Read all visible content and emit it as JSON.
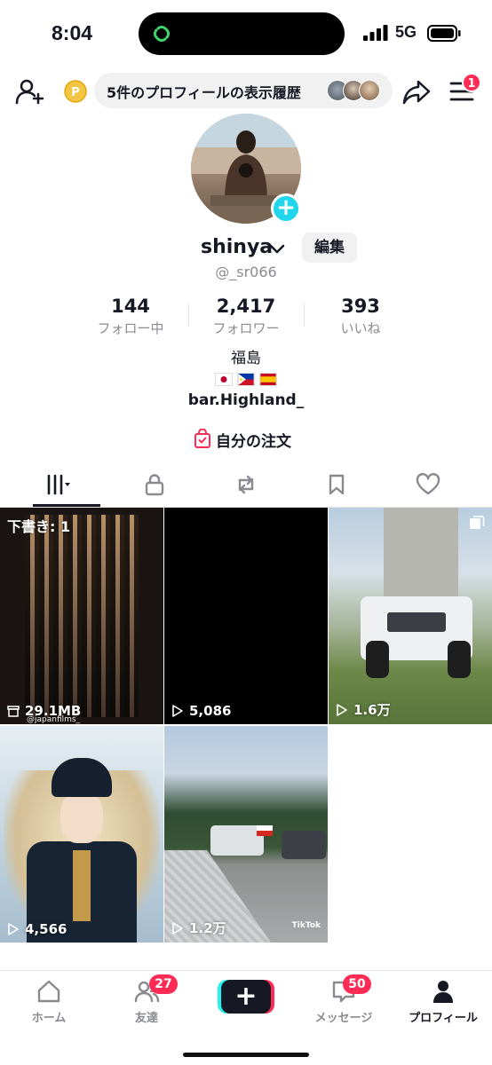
{
  "status_bar": {
    "time": "8:04",
    "network": "5G"
  },
  "top_bar": {
    "history_text": "5件のプロフィールの表示履歴",
    "notification_count": "1"
  },
  "profile": {
    "name": "shinya",
    "edit_label": "編集",
    "handle": "@_sr066",
    "stats": [
      {
        "value": "144",
        "label": "フォロー中"
      },
      {
        "value": "2,417",
        "label": "フォロワー"
      },
      {
        "value": "393",
        "label": "いいね"
      }
    ],
    "bio_location": "福島",
    "bio_flags": [
      "Japan flag",
      "Philippines flag",
      "Spain flag"
    ],
    "bio_link": "bar.Highland_",
    "orders_label": "自分の注文"
  },
  "tabs": [
    {
      "name": "videos-grid",
      "active": true
    },
    {
      "name": "private",
      "active": false
    },
    {
      "name": "reposts",
      "active": false
    },
    {
      "name": "favorites",
      "active": false
    },
    {
      "name": "liked",
      "active": false
    }
  ],
  "videos": [
    {
      "overlay": "下書き: 1",
      "count": "29.1MB",
      "count_icon": "archive-icon",
      "watermark": "@japanfilms_"
    },
    {
      "count": "5,086",
      "count_icon": "play-icon"
    },
    {
      "count": "1.6万",
      "count_icon": "play-icon",
      "multi": true
    },
    {
      "count": "4,566",
      "count_icon": "play-icon"
    },
    {
      "count": "1.2万",
      "count_icon": "play-icon",
      "watermark": "TikTok"
    }
  ],
  "bottom_nav": {
    "home": "ホーム",
    "friends": "友達",
    "friends_badge": "27",
    "create": "+",
    "messages": "メッセージ",
    "messages_badge": "50",
    "profile": "プロフィール"
  },
  "colors": {
    "accent": "#fe2c55",
    "cyan": "#25f4ee",
    "avatar_plus": "#20d5ec",
    "text": "#161823",
    "muted": "#8a8b91"
  }
}
